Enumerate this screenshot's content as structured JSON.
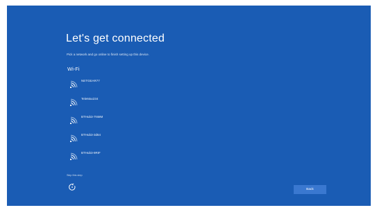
{
  "screen": {
    "title": "Let's get connected",
    "subtitle": "Pick a network and go online to finish setting up this device.",
    "section_label": "Wi-Fi",
    "skip_label": "Skip this step",
    "back_label": "Back"
  },
  "networks": [
    {
      "name": "NETGEAR77",
      "icon": "wifi-icon"
    },
    {
      "name": "TeleMax234",
      "icon": "wifi-icon"
    },
    {
      "name": "BTHub3-7NMM",
      "icon": "wifi-icon"
    },
    {
      "name": "BTHub3-3d64",
      "icon": "wifi-icon"
    },
    {
      "name": "BTHub3-9RIF",
      "icon": "wifi-icon"
    }
  ],
  "colors": {
    "background": "#1a5cb4",
    "button": "#3a78d0",
    "text": "#ffffff"
  },
  "icons": {
    "accessibility": "ease-of-access-icon"
  }
}
